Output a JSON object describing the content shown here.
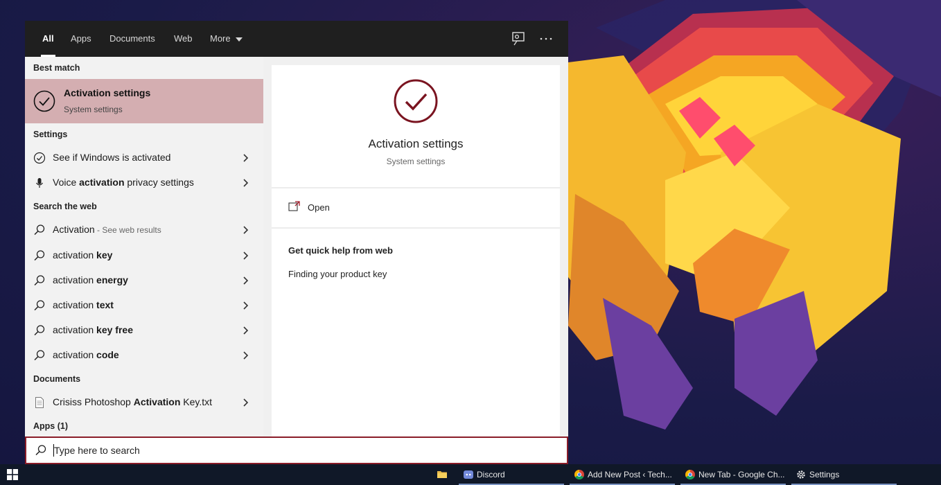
{
  "tabs": [
    {
      "label": "All"
    },
    {
      "label": "Apps"
    },
    {
      "label": "Documents"
    },
    {
      "label": "Web"
    },
    {
      "label": "More"
    }
  ],
  "sections": {
    "best_match": "Best match",
    "settings": "Settings",
    "search_web": "Search the web",
    "documents": "Documents",
    "apps": "Apps (1)"
  },
  "best_match": {
    "title": "Activation settings",
    "subtitle": "System settings"
  },
  "settings_items": [
    {
      "label": "See if Windows is activated"
    },
    {
      "pre": "Voice ",
      "bold": "activation",
      "post": " privacy settings"
    }
  ],
  "web_items": [
    {
      "label": "Activation",
      "suffix": " - See web results"
    },
    {
      "pre": "activation ",
      "bold": "key"
    },
    {
      "pre": "activation ",
      "bold": "energy"
    },
    {
      "pre": "activation ",
      "bold": "text"
    },
    {
      "pre": "activation ",
      "bold": "key free"
    },
    {
      "pre": "activation ",
      "bold": "code"
    }
  ],
  "document_items": [
    {
      "pre": "Crisiss Photoshop ",
      "bold": "Activation",
      "post": " Key.txt"
    }
  ],
  "preview": {
    "title": "Activation settings",
    "subtitle": "System settings",
    "open_label": "Open",
    "help_heading": "Get quick help from web",
    "help_link": "Finding your product key"
  },
  "search": {
    "placeholder": "Type here to search",
    "value": ""
  },
  "taskbar": {
    "apps": [
      {
        "label": "Discord"
      },
      {
        "label": "Add New Post ‹ Tech..."
      },
      {
        "label": "New Tab - Google Ch..."
      },
      {
        "label": "Settings"
      }
    ]
  },
  "colors": {
    "accent": "#8a1c28",
    "best_match_bg": "#d4aeb1",
    "topbar": "#1f1f1f",
    "taskbar": "#101828"
  }
}
